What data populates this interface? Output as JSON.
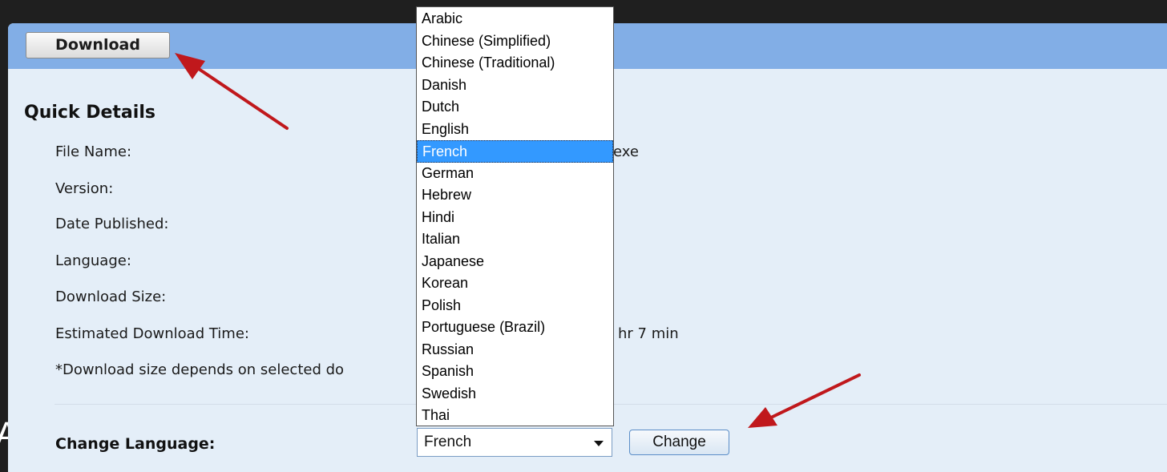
{
  "background_text": "A",
  "toolbar": {
    "download_label": "Download"
  },
  "quick_details": {
    "title": "Quick Details",
    "rows": [
      {
        "label": "File Name:",
        "value_fragment": "exe"
      },
      {
        "label": "Version:",
        "value_fragment": ""
      },
      {
        "label": "Date Published:",
        "value_fragment": ""
      },
      {
        "label": "Language:",
        "value_fragment": ""
      },
      {
        "label": "Download Size:",
        "value_fragment": ""
      },
      {
        "label": "Estimated Download Time:",
        "value_fragment": "hr 7 min"
      }
    ],
    "footnote": "*Download size depends on selected do"
  },
  "change_language": {
    "label": "Change Language:",
    "selected_value": "French",
    "button_label": "Change",
    "options": [
      "Arabic",
      "Chinese (Simplified)",
      "Chinese (Traditional)",
      "Danish",
      "Dutch",
      "English",
      "French",
      "German",
      "Hebrew",
      "Hindi",
      "Italian",
      "Japanese",
      "Korean",
      "Polish",
      "Portuguese (Brazil)",
      "Russian",
      "Spanish",
      "Swedish",
      "Thai"
    ],
    "highlighted_index": 6
  },
  "colors": {
    "page_background": "#1f1f1f",
    "panel_background": "#e4eef8",
    "header_bar": "#82aee6",
    "highlight": "#3399ff",
    "annotation_arrow": "#c0181c"
  },
  "icons": {
    "dropdown_arrow": "chevron-down-icon",
    "annotation": "red-arrow-icon"
  }
}
